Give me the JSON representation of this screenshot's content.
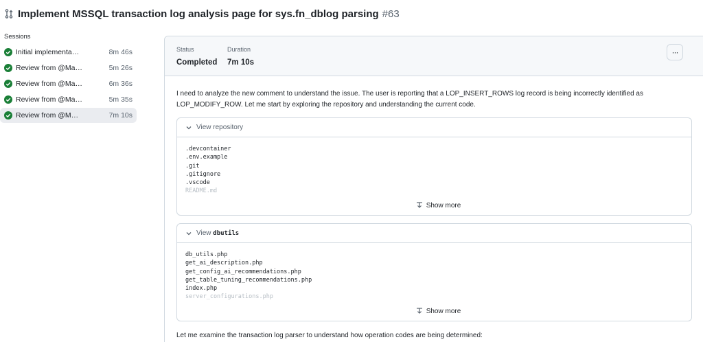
{
  "title": {
    "text": "Implement MSSQL transaction log analysis page for sys.fn_dblog parsing",
    "number": "#63"
  },
  "sidebar": {
    "heading": "Sessions",
    "sessions": [
      {
        "label": "Initial implementa…",
        "duration": "8m 46s",
        "active": false
      },
      {
        "label": "Review from @Ma…",
        "duration": "5m 26s",
        "active": false
      },
      {
        "label": "Review from @Ma…",
        "duration": "6m 36s",
        "active": false
      },
      {
        "label": "Review from @Ma…",
        "duration": "5m 35s",
        "active": false
      },
      {
        "label": "Review from @M…",
        "duration": "7m 10s",
        "active": true
      }
    ]
  },
  "panel": {
    "status_label": "Status",
    "status_value": "Completed",
    "duration_label": "Duration",
    "duration_value": "7m 10s",
    "more_label": "···",
    "message1_line1": "I need to analyze the new comment to understand the issue. The user is reporting that a LOP_INSERT_ROWS log record is being incorrectly identified as",
    "message1_line2": "LOP_MODIFY_ROW. Let me start by exploring the repository and understanding the current code.",
    "card1": {
      "title": "View repository",
      "files": [
        ".devcontainer",
        ".env.example",
        ".git",
        ".gitignore",
        ".vscode",
        "README.md"
      ],
      "show_more": "Show more"
    },
    "card2": {
      "title_prefix": "View",
      "title_code": "dbutils",
      "files": [
        "db_utils.php",
        "get_ai_description.php",
        "get_config_ai_recommendations.php",
        "get_table_tuning_recommendations.php",
        "index.php",
        "server_configurations.php"
      ],
      "show_more": "Show more"
    },
    "message2": "Let me examine the transaction log parser to understand how operation codes are being determined:"
  },
  "colors": {
    "success": "#1a7f37",
    "border": "#d1d9e0",
    "muted": "#59636e",
    "active_bg": "#eaecf0"
  }
}
